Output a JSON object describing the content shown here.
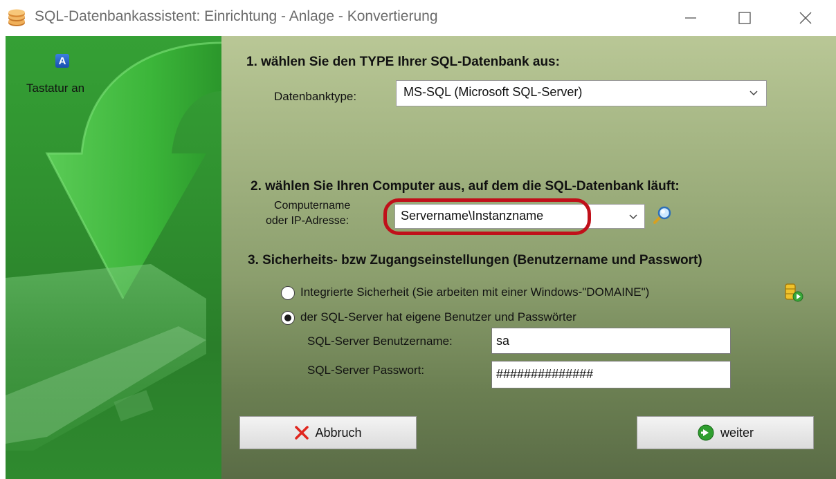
{
  "window": {
    "title": "SQL-Datenbankassistent:  Einrichtung - Anlage - Konvertierung",
    "app_icon": "database-coins-icon",
    "controls": [
      "minimize-icon",
      "maximize-icon",
      "close-icon"
    ]
  },
  "sidebar": {
    "keyboard_icon_glyph": "A",
    "keyboard_label": "Tastatur an"
  },
  "section1": {
    "heading": "1. wählen Sie den TYPE Ihrer SQL-Datenbank aus:",
    "db_type_label": "Datenbanktype:",
    "db_type_value": "MS-SQL (Microsoft SQL-Server)"
  },
  "section2": {
    "heading": "2. wählen Sie Ihren Computer aus, auf dem die SQL-Datenbank läuft:",
    "computer_label_line1": "Computername",
    "computer_label_line2": "oder IP-Adresse:",
    "computer_value": "Servername\\Instanzname",
    "search_icon": "magnifier-icon"
  },
  "section3": {
    "heading": "3. Sicherheits- bzw Zugangseinstellungen (Benutzername und Passwort)",
    "option_integrated": "Integrierte Sicherheit (Sie arbeiten mit einer Windows-\"DOMAINE\")",
    "option_sql_auth": "der SQL-Server hat eigene Benutzer und Passwörter",
    "selected_option": "sql_auth",
    "username_label": "SQL-Server Benutzername:",
    "username_value": "sa",
    "password_label": "SQL-Server Passwort:",
    "password_value": "##############"
  },
  "buttons": {
    "cancel_label": "Abbruch",
    "next_label": "weiter"
  },
  "colors": {
    "highlight": "#c0101a",
    "sidebar_green": "#2f8f2f"
  }
}
